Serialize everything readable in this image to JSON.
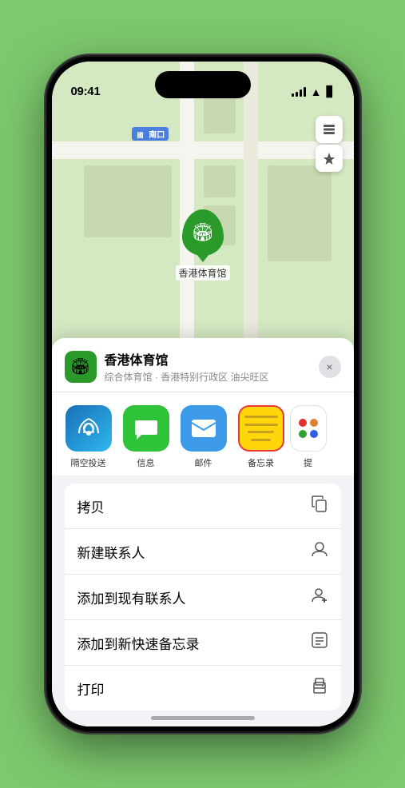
{
  "status_bar": {
    "time": "09:41",
    "location_icon": "▶"
  },
  "map": {
    "road_label": "南口",
    "road_prefix": "國",
    "location_pin_label": "香港体育馆"
  },
  "bottom_sheet": {
    "venue_name": "香港体育馆",
    "venue_sub": "综合体育馆 · 香港特别行政区 油尖旺区",
    "close_label": "×"
  },
  "share_items": [
    {
      "id": "airdrop",
      "label": "隔空投送",
      "icon": "📡"
    },
    {
      "id": "messages",
      "label": "信息",
      "icon": "💬"
    },
    {
      "id": "mail",
      "label": "邮件",
      "icon": "✉️"
    },
    {
      "id": "notes",
      "label": "备忘录",
      "icon": "notes"
    },
    {
      "id": "more",
      "label": "提",
      "icon": "more"
    }
  ],
  "action_items": [
    {
      "label": "拷贝",
      "icon": "copy"
    },
    {
      "label": "新建联系人",
      "icon": "person"
    },
    {
      "label": "添加到现有联系人",
      "icon": "person-add"
    },
    {
      "label": "添加到新快速备忘录",
      "icon": "note"
    },
    {
      "label": "打印",
      "icon": "printer"
    }
  ]
}
